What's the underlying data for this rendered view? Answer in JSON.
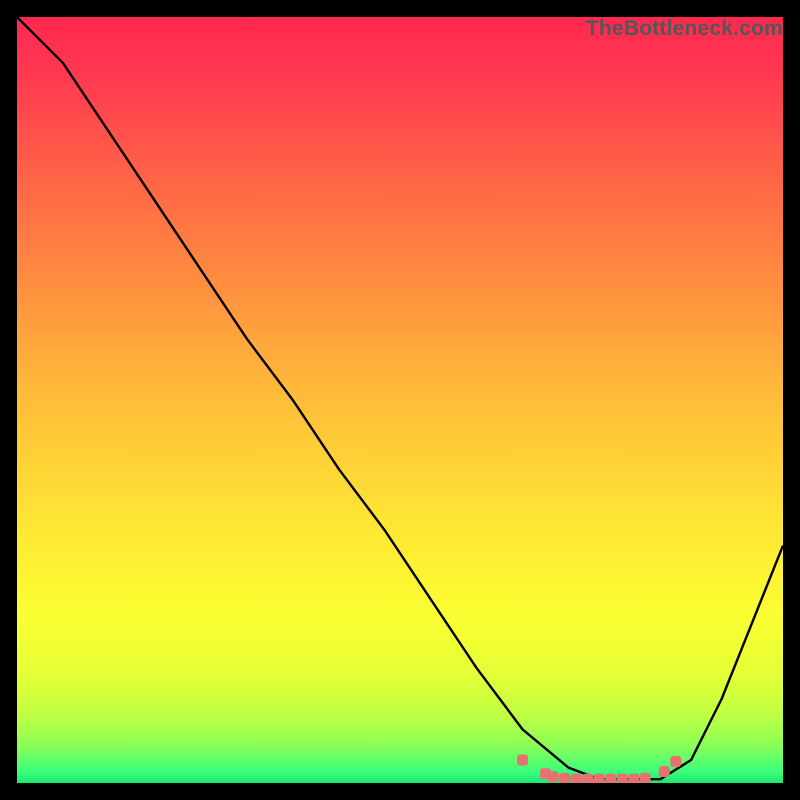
{
  "watermark": "TheBottleneck.com",
  "chart_data": {
    "type": "line",
    "title": "",
    "xlabel": "",
    "ylabel": "",
    "xlim": [
      0,
      100
    ],
    "ylim": [
      0,
      100
    ],
    "x": [
      0,
      6,
      12,
      18,
      24,
      30,
      36,
      42,
      48,
      54,
      60,
      66,
      72,
      76,
      80,
      84,
      88,
      92,
      96,
      100
    ],
    "values": [
      100,
      94,
      85,
      76,
      67,
      58,
      50,
      41,
      33,
      24,
      15,
      7,
      2,
      0.5,
      0.5,
      0.5,
      3,
      11,
      21,
      31
    ],
    "minimum_region": {
      "x_start": 66,
      "x_end": 86,
      "y": 0.5
    },
    "markers": {
      "x": [
        66,
        69,
        70,
        71.5,
        73,
        74.5,
        76,
        77.5,
        79,
        80.5,
        82,
        84.5,
        86
      ],
      "y": [
        3,
        1.2,
        0.8,
        0.6,
        0.5,
        0.5,
        0.5,
        0.5,
        0.5,
        0.5,
        0.6,
        1.5,
        2.8
      ],
      "color": "#e77070"
    },
    "gradient_stops": [
      {
        "offset": 0.0,
        "color": "#ff2850"
      },
      {
        "offset": 0.08,
        "color": "#ff3a50"
      },
      {
        "offset": 0.2,
        "color": "#ff6147"
      },
      {
        "offset": 0.35,
        "color": "#ff8f3f"
      },
      {
        "offset": 0.5,
        "color": "#ffbd39"
      },
      {
        "offset": 0.65,
        "color": "#ffe334"
      },
      {
        "offset": 0.78,
        "color": "#fbff32"
      },
      {
        "offset": 0.86,
        "color": "#e4ff36"
      },
      {
        "offset": 0.91,
        "color": "#c0ff42"
      },
      {
        "offset": 0.95,
        "color": "#8dff56"
      },
      {
        "offset": 0.985,
        "color": "#3bff7a"
      },
      {
        "offset": 1.0,
        "color": "#19e86f"
      }
    ]
  }
}
